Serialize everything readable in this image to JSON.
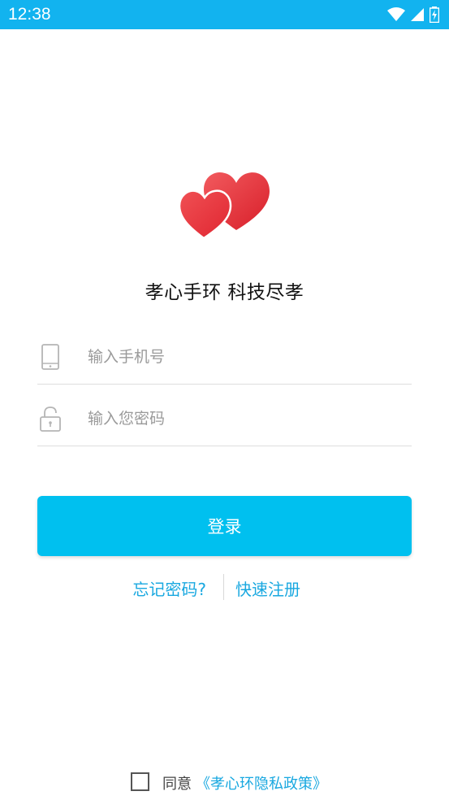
{
  "status_bar": {
    "time": "12:38",
    "bg_color": "#12b3ef",
    "icons": [
      "wifi-icon",
      "signal-icon",
      "battery-charging-icon"
    ]
  },
  "logo": {
    "icon": "double-heart-logo",
    "color": "#e8343b"
  },
  "slogan": "孝心手环 科技尽孝",
  "phone_field": {
    "icon": "phone-icon",
    "placeholder": "输入手机号",
    "value": ""
  },
  "password_field": {
    "icon": "lock-icon",
    "placeholder": "输入您密码",
    "value": ""
  },
  "login_button": {
    "label": "登录",
    "color": "#00c0ef"
  },
  "links": {
    "forgot_password": "忘记密码?",
    "quick_register": "快速注册",
    "color": "#19a8e0"
  },
  "agreement": {
    "checked": false,
    "prefix": "同意",
    "policy_link": "《孝心环隐私政策》"
  }
}
